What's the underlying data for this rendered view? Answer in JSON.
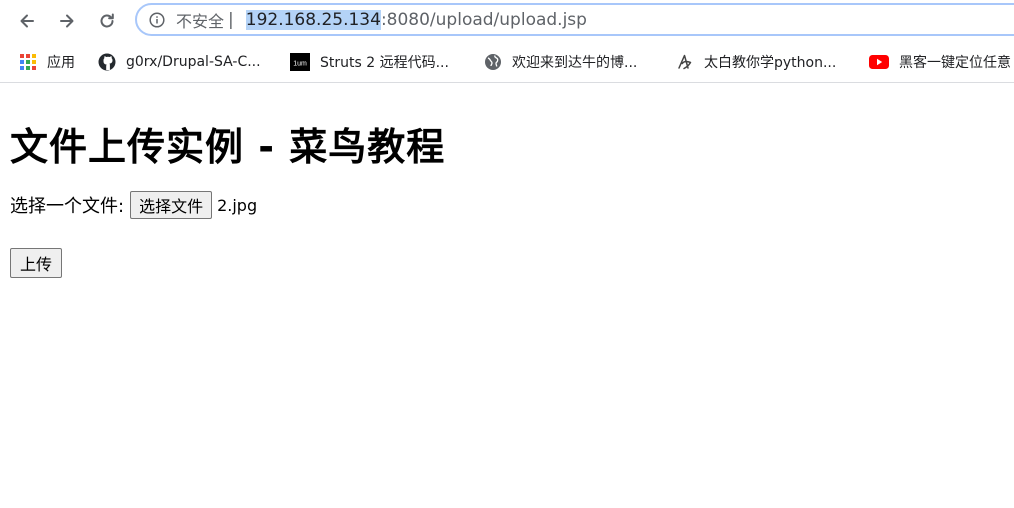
{
  "browser": {
    "security_label": "不安全",
    "separator": "|",
    "url_host": "192.168.25.134",
    "url_rest": ":8080/upload/upload.jsp"
  },
  "bookmarks": [
    {
      "label": "应用",
      "icon": "apps-grid-icon"
    },
    {
      "label": "g0rx/Drupal-SA-C...",
      "icon": "github-icon"
    },
    {
      "label": "Struts 2 远程代码...",
      "icon": "1um-site-icon"
    },
    {
      "label": "欢迎来到达牛的博...",
      "icon": "globe-icon"
    },
    {
      "label": "太白教你学python...",
      "icon": "site-logo-icon"
    },
    {
      "label": "黑客一键定位任意",
      "icon": "youtube-icon"
    }
  ],
  "page": {
    "title": "文件上传实例 - 菜鸟教程",
    "file_label": "选择一个文件:",
    "file_button": "选择文件",
    "file_name": "2.jpg",
    "submit_button": "上传"
  },
  "colors": {
    "omnibox_border": "#a8c7fa",
    "url_highlight": "#b4d3f7",
    "youtube_red": "#ff0000"
  }
}
